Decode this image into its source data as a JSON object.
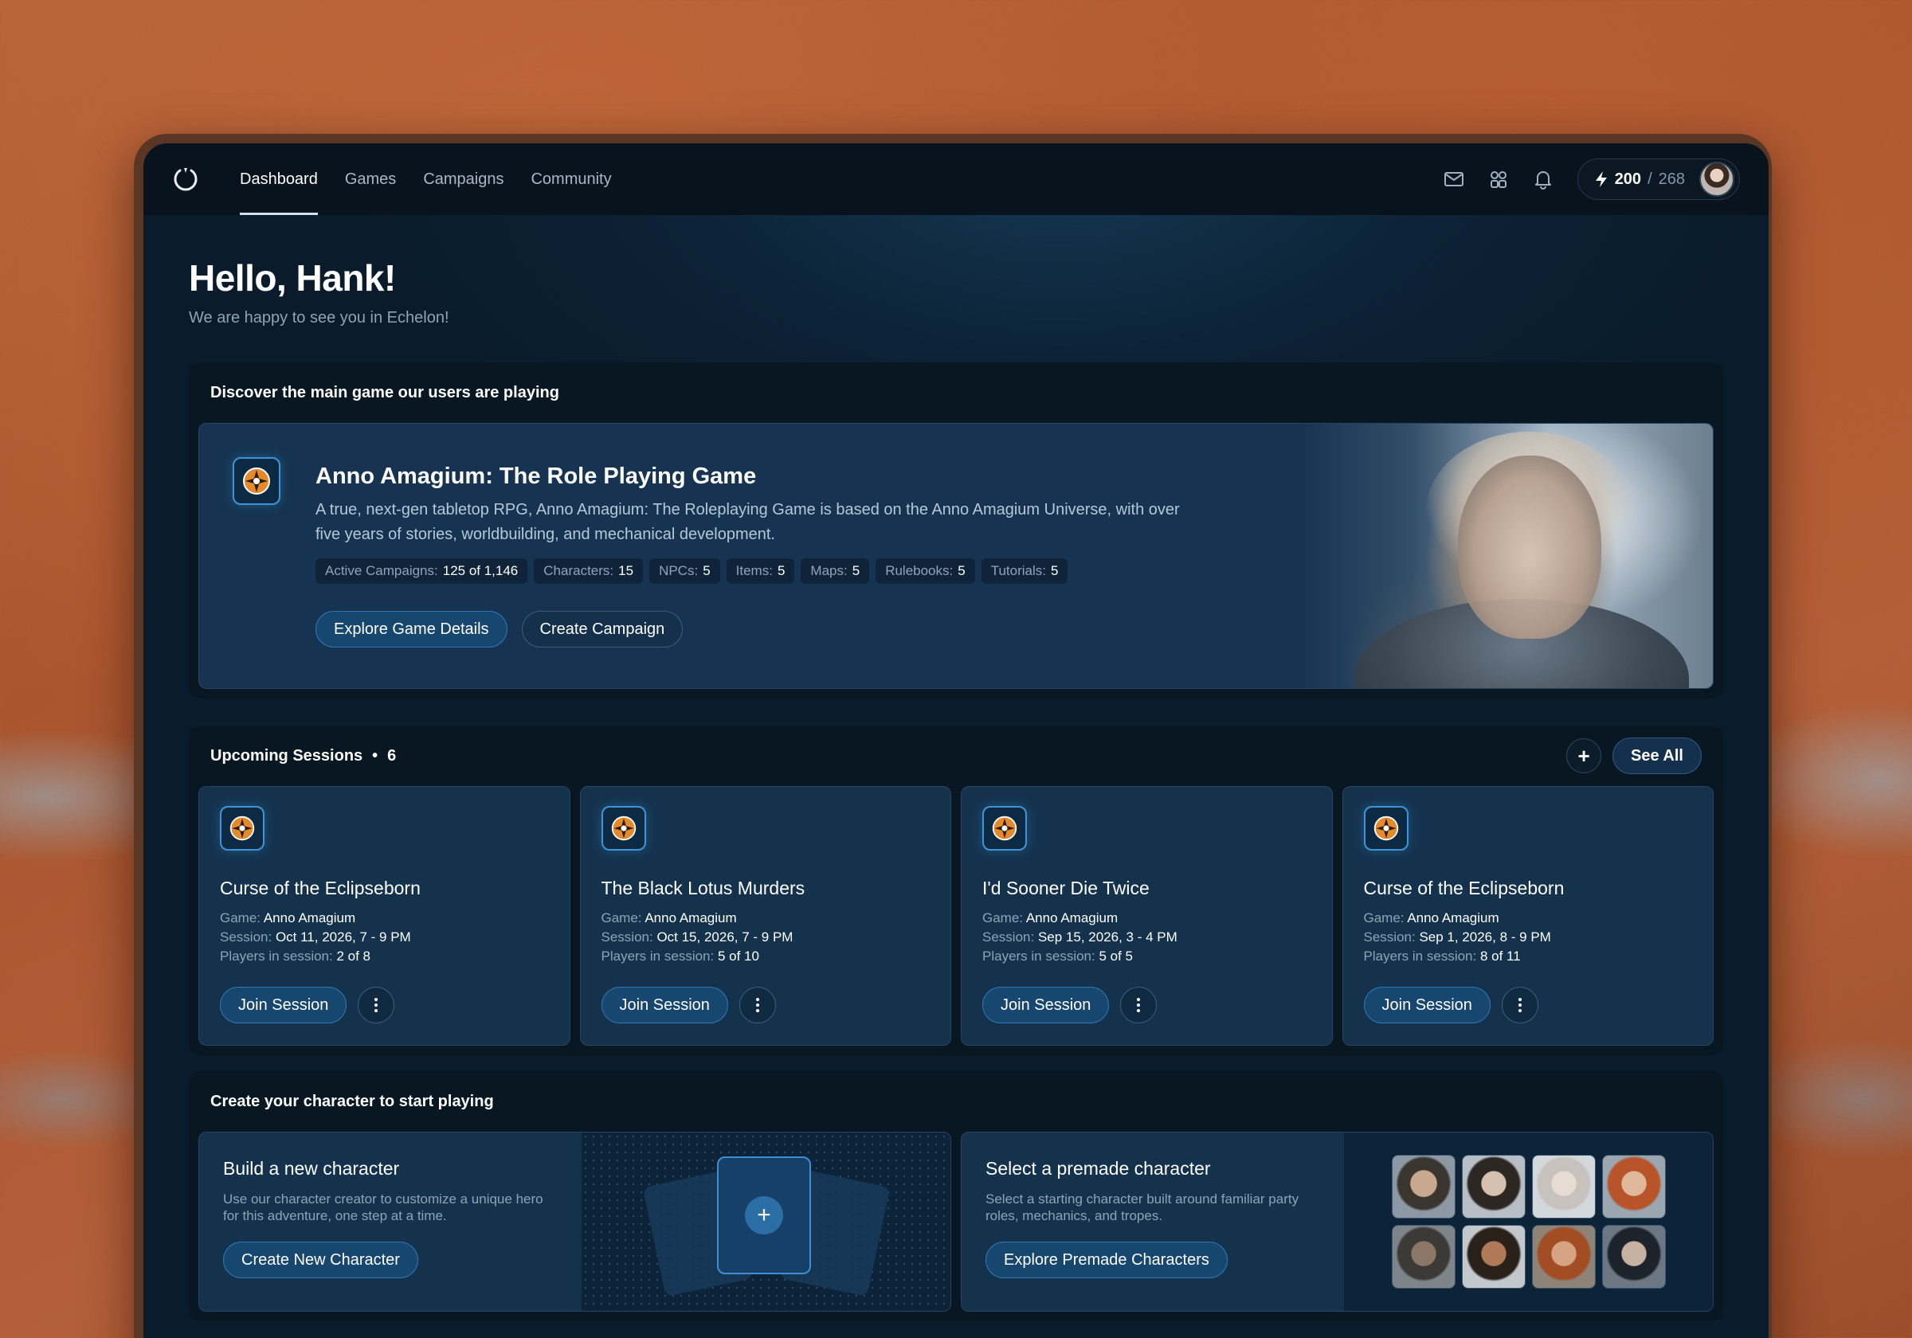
{
  "nav": {
    "links": [
      "Dashboard",
      "Games",
      "Campaigns",
      "Community"
    ],
    "active": "Dashboard",
    "credits_current": "200",
    "credits_sep": "/",
    "credits_max": "268",
    "icons": [
      "mail-icon",
      "apps-icon",
      "bell-icon",
      "bolt-icon"
    ]
  },
  "greeting": {
    "title": "Hello, Hank!",
    "subtitle": "We are happy to see you in Echelon!"
  },
  "featured": {
    "section_title": "Discover the main game our users are playing",
    "title": "Anno Amagium: The Role Playing Game",
    "description": "A true, next-gen tabletop RPG, Anno Amagium: The Roleplaying Game is based on the Anno Amagium Universe, with over five years of stories, worldbuilding, and mechanical development.",
    "stats": [
      {
        "label": "Active Campaigns:",
        "value": "125 of 1,146"
      },
      {
        "label": "Characters:",
        "value": "15"
      },
      {
        "label": "NPCs:",
        "value": "5"
      },
      {
        "label": "Items:",
        "value": "5"
      },
      {
        "label": "Maps:",
        "value": "5"
      },
      {
        "label": "Rulebooks:",
        "value": "5"
      },
      {
        "label": "Tutorials:",
        "value": "5"
      }
    ],
    "primary_btn": "Explore Game Details",
    "secondary_btn": "Create Campaign"
  },
  "sessions": {
    "title": "Upcoming Sessions",
    "dot": "•",
    "count": "6",
    "see_all": "See All",
    "add": "+",
    "game_label": "Game:",
    "session_label": "Session:",
    "players_label": "Players in session:",
    "join_label": "Join Session",
    "items": [
      {
        "title": "Curse of the Eclipseborn",
        "game": "Anno Amagium",
        "session": "Oct 11, 2026, 7 - 9 PM",
        "players": "2 of 8"
      },
      {
        "title": "The Black Lotus Murders",
        "game": "Anno Amagium",
        "session": "Oct 15, 2026, 7 - 9 PM",
        "players": "5 of 10"
      },
      {
        "title": "I'd Sooner Die Twice",
        "game": "Anno Amagium",
        "session": "Sep 15, 2026, 3 - 4 PM",
        "players": "5 of 5"
      },
      {
        "title": "Curse of the Eclipseborn",
        "game": "Anno Amagium",
        "session": "Sep 1, 2026, 8 - 9 PM",
        "players": "8 of 11"
      }
    ]
  },
  "characters": {
    "section_title": "Create your character to start playing",
    "build": {
      "title": "Build a new character",
      "desc": "Use our character creator to customize a unique hero for this adventure, one step at a time.",
      "btn": "Create New Character",
      "plus": "+"
    },
    "premade": {
      "title": "Select a premade character",
      "desc": "Select a starting character built around familiar party roles, mechanics, and tropes.",
      "btn": "Explore Premade Characters"
    }
  },
  "colors": {
    "accent": "#2f77b3",
    "panel": "#081722",
    "card": "#15324d"
  }
}
